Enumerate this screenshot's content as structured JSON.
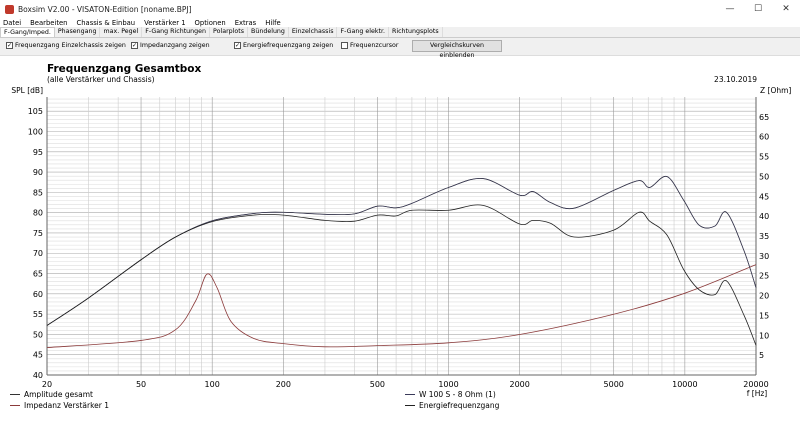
{
  "window": {
    "title": "Boxsim V2.00 - VISATON-Edition [noname.BPJ]",
    "minimize": "—",
    "maximize": "☐",
    "close": "✕"
  },
  "menu": [
    "Datei",
    "Bearbeiten",
    "Chassis & Einbau",
    "Verstärker 1",
    "Optionen",
    "Extras",
    "Hilfe"
  ],
  "tabs": [
    "F-Gang/Imped.",
    "Phasengang",
    "max. Pegel",
    "F-Gang Richtungen",
    "Polarplots",
    "Bündelung",
    "Einzelchassis",
    "F-Gang elektr.",
    "Richtungsplots"
  ],
  "options": {
    "einzel": {
      "label": "Frequenzgang Einzelchassis zeigen",
      "checked": true
    },
    "imped": {
      "label": "Impedanzgang zeigen",
      "checked": true
    },
    "energie": {
      "label": "Energiefrequenzgang zeigen",
      "checked": true
    },
    "cursor": {
      "label": "Frequenzcursor",
      "checked": false
    },
    "compare_button": "Vergleichskurven einblenden"
  },
  "chart_data": {
    "type": "line",
    "title": "Frequenzgang Gesamtbox",
    "subtitle": "(alle Verstärker und Chassis)",
    "date": "23.10.2019",
    "ylabel": "SPL [dB]",
    "y2label": "Z [Ohm]",
    "xlabel": "f [Hz]",
    "xscale": "log",
    "xlim": [
      20,
      20000
    ],
    "xticks": [
      "20",
      "50",
      "100",
      "200",
      "500",
      "1000",
      "2000",
      "5000",
      "10000",
      "20000"
    ],
    "yticks": [
      "40",
      "45",
      "50",
      "55",
      "60",
      "65",
      "70",
      "75",
      "80",
      "85",
      "90",
      "95",
      "100",
      "105"
    ],
    "y2ticks": [
      "5",
      "10",
      "15",
      "20",
      "25",
      "30",
      "35",
      "40",
      "45",
      "50",
      "55",
      "60",
      "65"
    ],
    "ylim": [
      40,
      108.5
    ],
    "y2lim": [
      0,
      70
    ],
    "series": [
      {
        "name": "Amplitude gesamt",
        "axis": "left",
        "color": "#333333",
        "x": [
          20,
          30,
          50,
          70,
          100,
          150,
          200,
          300,
          400,
          500,
          600,
          700,
          1000,
          1400,
          2000,
          2280,
          2700,
          3400,
          5000,
          6400,
          7100,
          8400,
          9900,
          11500,
          13400,
          15000,
          17800,
          20000
        ],
        "y": [
          52.2,
          59,
          68.4,
          74,
          78,
          79.8,
          80.1,
          79.6,
          79.7,
          81.6,
          81.2,
          82.3,
          86.2,
          88.4,
          84.3,
          85.2,
          82.5,
          81.1,
          85.5,
          87.9,
          86.2,
          88.9,
          83,
          76.9,
          76.7,
          80.1,
          70.6,
          61.5
        ]
      },
      {
        "name": "Impedanz Verstärker 1",
        "axis": "right",
        "color": "#8b3a3a",
        "x": [
          20,
          50,
          70,
          85,
          95,
          105,
          120,
          150,
          200,
          300,
          500,
          1000,
          2000,
          5000,
          10000,
          20000
        ],
        "y": [
          6.9,
          8.7,
          11.4,
          18.6,
          25.4,
          21.9,
          13.5,
          9.2,
          7.9,
          7.1,
          7.4,
          8.1,
          10.2,
          15.3,
          20.6,
          27.8
        ]
      },
      {
        "name": "W 100 S - 8 Ohm (1)",
        "axis": "left",
        "color": "#3a3a5a",
        "x": [
          20,
          30,
          50,
          70,
          100,
          150,
          200,
          300,
          400,
          500,
          600,
          700,
          1000,
          1400,
          2000,
          2280,
          2700,
          3400,
          5000,
          6400,
          7100,
          8400,
          9900,
          11500,
          13400,
          15000,
          17800,
          20000
        ],
        "y": [
          52.2,
          59,
          68.4,
          74,
          78,
          79.8,
          80.1,
          79.6,
          79.7,
          81.6,
          81.2,
          82.3,
          86.2,
          88.4,
          84.3,
          85.2,
          82.5,
          81.1,
          85.5,
          87.9,
          86.2,
          88.9,
          83,
          76.9,
          76.7,
          80.1,
          70.6,
          61.5
        ]
      },
      {
        "name": "Energiefrequenzgang",
        "axis": "left",
        "color": "#222222",
        "x": [
          20,
          30,
          50,
          70,
          100,
          150,
          200,
          300,
          400,
          500,
          600,
          700,
          1000,
          1400,
          2000,
          2280,
          2700,
          3400,
          5000,
          6400,
          7100,
          8400,
          9900,
          11500,
          13400,
          15000,
          17800,
          20000
        ],
        "y": [
          52.2,
          59,
          68.4,
          74,
          77.8,
          79.4,
          79.4,
          78.1,
          77.9,
          79.4,
          79.2,
          80.6,
          80.6,
          81.8,
          77.2,
          78.1,
          77.4,
          74,
          75.7,
          80.1,
          77.9,
          74.5,
          65.9,
          61,
          59.8,
          63.2,
          54.7,
          47.3
        ]
      }
    ]
  }
}
